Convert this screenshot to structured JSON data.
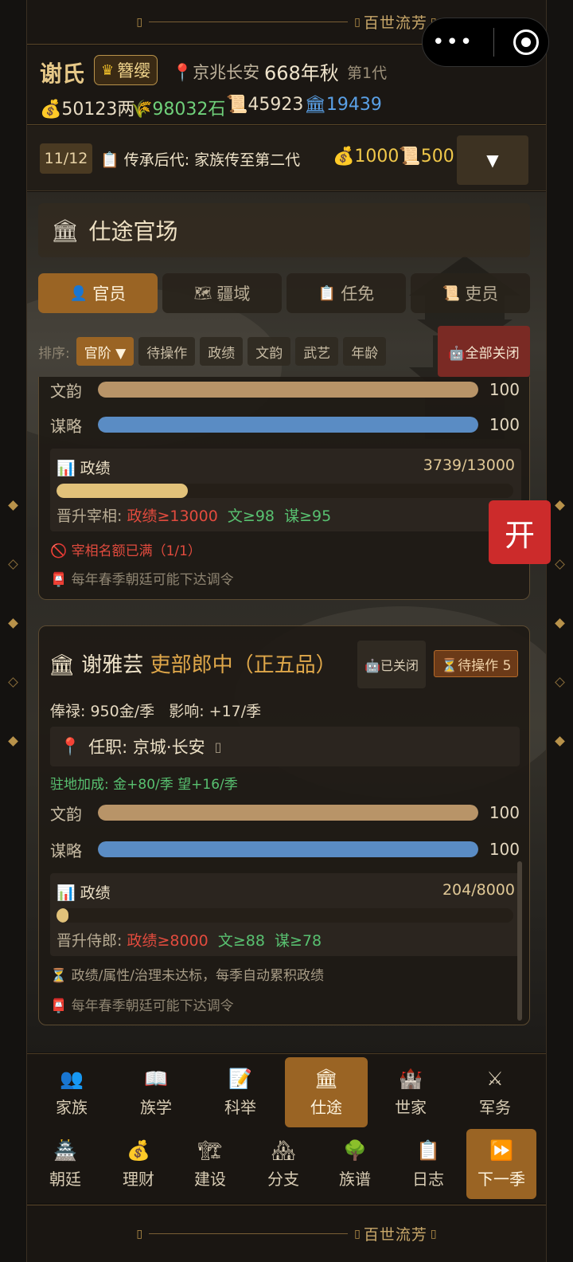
{
  "banner": {
    "title": "百世流芳",
    "mark": "▯"
  },
  "header": {
    "clan": "谢氏",
    "rank": "簪缨",
    "location": "京兆长安",
    "year": "668年秋",
    "generation": "第1代",
    "resources": [
      {
        "icon": "money-bag-icon",
        "text": "💰50123两",
        "color": "#e8dcc4"
      },
      {
        "icon": "grain-icon",
        "text": "🌾98032石",
        "color": "#6fd07a"
      },
      {
        "icon": "scroll-icon",
        "text": "📜45923",
        "color": "#e8dcc4"
      },
      {
        "icon": "bank-icon",
        "text": "🏛19439",
        "color": "#5aa0e6"
      }
    ]
  },
  "quest": {
    "count": "11/12",
    "text": "传承后代: 家族传至第二代",
    "reward_money": "💰1000",
    "reward_scroll": "📜500",
    "toggle": "▼"
  },
  "section": {
    "title": "仕途官场"
  },
  "tabs": [
    {
      "icon": "👤",
      "label": "官员",
      "active": true
    },
    {
      "icon": "🗺",
      "label": "疆域",
      "active": false
    },
    {
      "icon": "📋",
      "label": "任免",
      "active": false
    },
    {
      "icon": "📜",
      "label": "吏员",
      "active": false
    }
  ],
  "sort": {
    "label": "排序:",
    "options": [
      "官阶 ▼",
      "待操作",
      "政绩",
      "文韵",
      "武艺",
      "年龄"
    ],
    "close_all": "🤖全部关闭"
  },
  "card1": {
    "stats": [
      {
        "label": "文韵",
        "value": 100,
        "max": 100,
        "color": "#b89468"
      },
      {
        "label": "谋略",
        "value": 100,
        "max": 100,
        "color": "#5a8cc4"
      }
    ],
    "performance": {
      "label": "政绩",
      "current": 3739,
      "target": 13000,
      "text": "3739/13000"
    },
    "promotion": {
      "prefix": "晋升宰相: ",
      "req1": "政绩≥13000",
      "req2": "文≥98",
      "req3": "谋≥95"
    },
    "warning": "🚫 宰相名额已满（1/1）",
    "notice": "📮 每年春季朝廷可能下达调令"
  },
  "open_button": "开",
  "card2": {
    "name": "谢雅芸",
    "title": "吏部郎中（正五品）",
    "auto_status": "🤖已关闭",
    "pending": "⏳待操作 5",
    "salary": "俸禄: 950金/季",
    "influence": "影响: +17/季",
    "post": "任职: 京城·长安",
    "post_mark": "▯",
    "bonus": "驻地加成: 金+80/季  望+16/季",
    "stats": [
      {
        "label": "文韵",
        "value": 100,
        "max": 100,
        "color": "#b89468"
      },
      {
        "label": "谋略",
        "value": 100,
        "max": 100,
        "color": "#5a8cc4"
      }
    ],
    "performance": {
      "label": "政绩",
      "current": 204,
      "target": 8000,
      "text": "204/8000"
    },
    "promotion": {
      "prefix": "晋升侍郎: ",
      "req1": "政绩≥8000",
      "req2": "文≥88",
      "req3": "谋≥78"
    },
    "info": "⏳ 政绩/属性/治理未达标，每季自动累积政绩",
    "notice": "📮 每年春季朝廷可能下达调令"
  },
  "nav": {
    "row1": [
      {
        "icon": "👥",
        "label": "家族"
      },
      {
        "icon": "📖",
        "label": "族学"
      },
      {
        "icon": "📝",
        "label": "科举"
      },
      {
        "icon": "🏛",
        "label": "仕途",
        "active": true
      },
      {
        "icon": "🏰",
        "label": "世家"
      },
      {
        "icon": "⚔",
        "label": "军务"
      }
    ],
    "row2": [
      {
        "icon": "🏯",
        "label": "朝廷"
      },
      {
        "icon": "💰",
        "label": "理财"
      },
      {
        "icon": "🏗",
        "label": "建设"
      },
      {
        "icon": "🏘",
        "label": "分支"
      },
      {
        "icon": "🌳",
        "label": "族谱"
      },
      {
        "icon": "📋",
        "label": "日志"
      },
      {
        "icon": "⏩",
        "label": "下一季",
        "next": true
      }
    ]
  }
}
